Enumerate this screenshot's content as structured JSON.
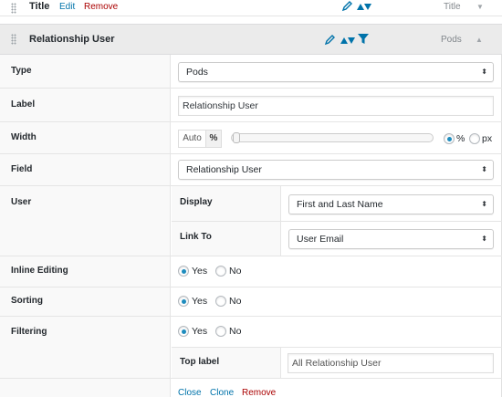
{
  "fields": {
    "title_row": {
      "name": "Title",
      "edit_label": "Edit",
      "remove_label": "Remove",
      "type_label": "Title",
      "caret": "▼"
    },
    "relationship_row": {
      "name": "Relationship User",
      "type_label": "Pods",
      "caret": "▲"
    }
  },
  "settings": {
    "type": {
      "label": "Type",
      "value": "Pods"
    },
    "label": {
      "label": "Label",
      "value": "Relationship User"
    },
    "width": {
      "label": "Width",
      "auto": "Auto",
      "pct_box": "%",
      "pct_option": "%",
      "px_option": "px",
      "selected_unit": "%"
    },
    "field": {
      "label": "Field",
      "value": "Relationship User"
    },
    "user": {
      "label": "User",
      "display": {
        "label": "Display",
        "value": "First and Last Name"
      },
      "link_to": {
        "label": "Link To",
        "value": "User Email"
      }
    },
    "inline_editing": {
      "label": "Inline Editing",
      "yes": "Yes",
      "no": "No",
      "selected": "Yes"
    },
    "sorting": {
      "label": "Sorting",
      "yes": "Yes",
      "no": "No",
      "selected": "Yes"
    },
    "filtering": {
      "label": "Filtering",
      "yes": "Yes",
      "no": "No",
      "selected": "Yes",
      "top_label": {
        "label": "Top label",
        "value": "All Relationship User"
      }
    }
  },
  "footer": {
    "close_label": "Close",
    "clone_label": "Clone",
    "remove_label": "Remove"
  },
  "select_arrow": "⬍",
  "colors": {
    "link": "#0073aa",
    "delete": "#aa0000",
    "radio_on": "#1e8cbe",
    "header_bg": "#ebebeb",
    "label_col_bg": "#f9f9f9"
  }
}
